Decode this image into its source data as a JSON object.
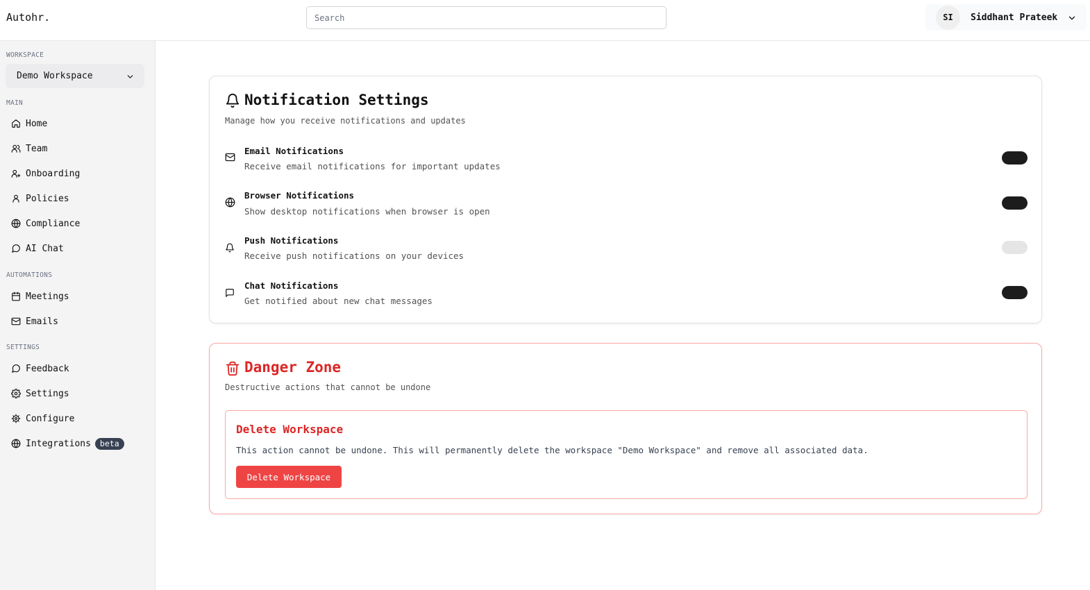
{
  "brand": "Autohr.",
  "search": {
    "placeholder": "Search"
  },
  "user": {
    "initials": "SI",
    "name": "Siddhant Prateek"
  },
  "sidebar": {
    "workspace_label": "WORKSPACE",
    "workspace_name": "Demo Workspace",
    "sections": [
      {
        "label": "MAIN",
        "items": [
          {
            "label": "Home",
            "icon": "home-icon"
          },
          {
            "label": "Team",
            "icon": "users-icon"
          },
          {
            "label": "Onboarding",
            "icon": "user-plus-icon"
          },
          {
            "label": "Policies",
            "icon": "user-icon"
          },
          {
            "label": "Compliance",
            "icon": "globe-icon"
          },
          {
            "label": "AI Chat",
            "icon": "chat-icon"
          }
        ]
      },
      {
        "label": "AUTOMATIONS",
        "items": [
          {
            "label": "Meetings",
            "icon": "calendar-icon"
          },
          {
            "label": "Emails",
            "icon": "mail-icon"
          }
        ]
      },
      {
        "label": "SETTINGS",
        "items": [
          {
            "label": "Feedback",
            "icon": "chat-icon"
          },
          {
            "label": "Settings",
            "icon": "gear-icon"
          },
          {
            "label": "Configure",
            "icon": "cog-icon"
          },
          {
            "label": "Integrations",
            "icon": "globe-icon",
            "badge": "beta"
          }
        ]
      }
    ]
  },
  "notifications": {
    "title": "Notification Settings",
    "description": "Manage how you receive notifications and updates",
    "items": [
      {
        "title": "Email Notifications",
        "description": "Receive email notifications for important updates",
        "enabled": true,
        "icon": "mail-icon"
      },
      {
        "title": "Browser Notifications",
        "description": "Show desktop notifications when browser is open",
        "enabled": true,
        "icon": "globe-icon"
      },
      {
        "title": "Push Notifications",
        "description": "Receive push notifications on your devices",
        "enabled": false,
        "icon": "bell-icon"
      },
      {
        "title": "Chat Notifications",
        "description": "Get notified about new chat messages",
        "enabled": true,
        "icon": "message-square-icon"
      }
    ]
  },
  "danger": {
    "title": "Danger Zone",
    "description": "Destructive actions that cannot be undone",
    "delete_title": "Delete Workspace",
    "delete_text": "This action cannot be undone. This will permanently delete the workspace \"Demo Workspace\" and remove all associated data.",
    "delete_button": "Delete Workspace"
  },
  "colors": {
    "danger": "#dc2626",
    "danger_button": "#ef4444",
    "toggle_on": "#1c1c1c",
    "toggle_off": "#e5e5e5"
  }
}
